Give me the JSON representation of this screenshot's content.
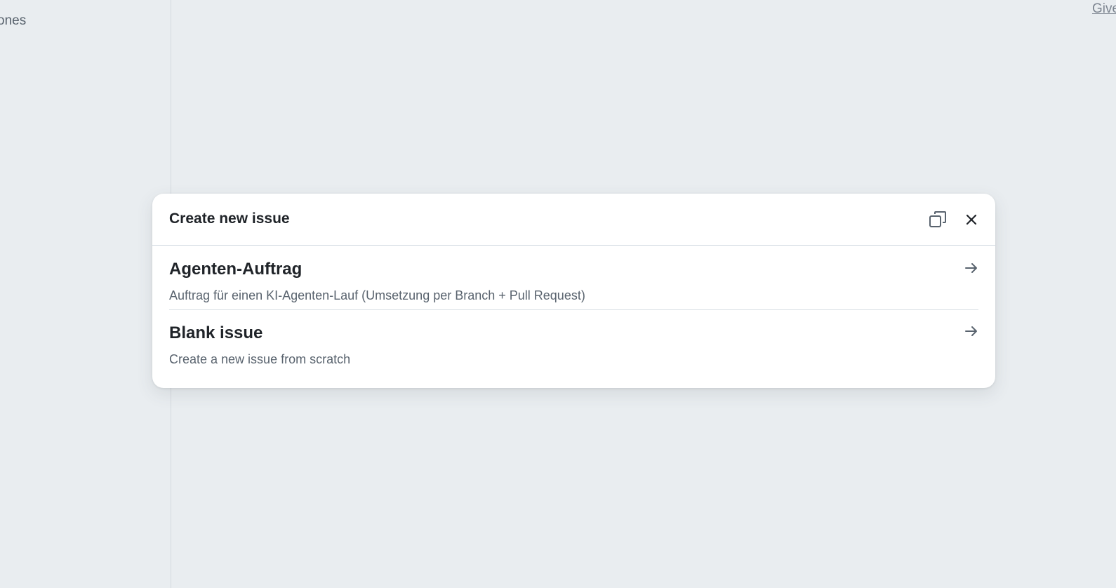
{
  "background": {
    "sidebar_fragment": "ones",
    "top_link": "Give"
  },
  "dialog": {
    "title": "Create new issue",
    "options": [
      {
        "title": "Agenten-Auftrag",
        "description": "Auftrag für einen KI-Agenten-Lauf (Umsetzung per Branch + Pull Request)"
      },
      {
        "title": "Blank issue",
        "description": "Create a new issue from scratch"
      }
    ]
  },
  "icons": {
    "copy": "copy-icon",
    "close": "close-icon",
    "arrow": "arrow-right-icon"
  },
  "colors": {
    "backdrop": "#e9edf0",
    "dialog_bg": "#ffffff",
    "title_text": "#1f2328",
    "muted_text": "#59636e"
  }
}
